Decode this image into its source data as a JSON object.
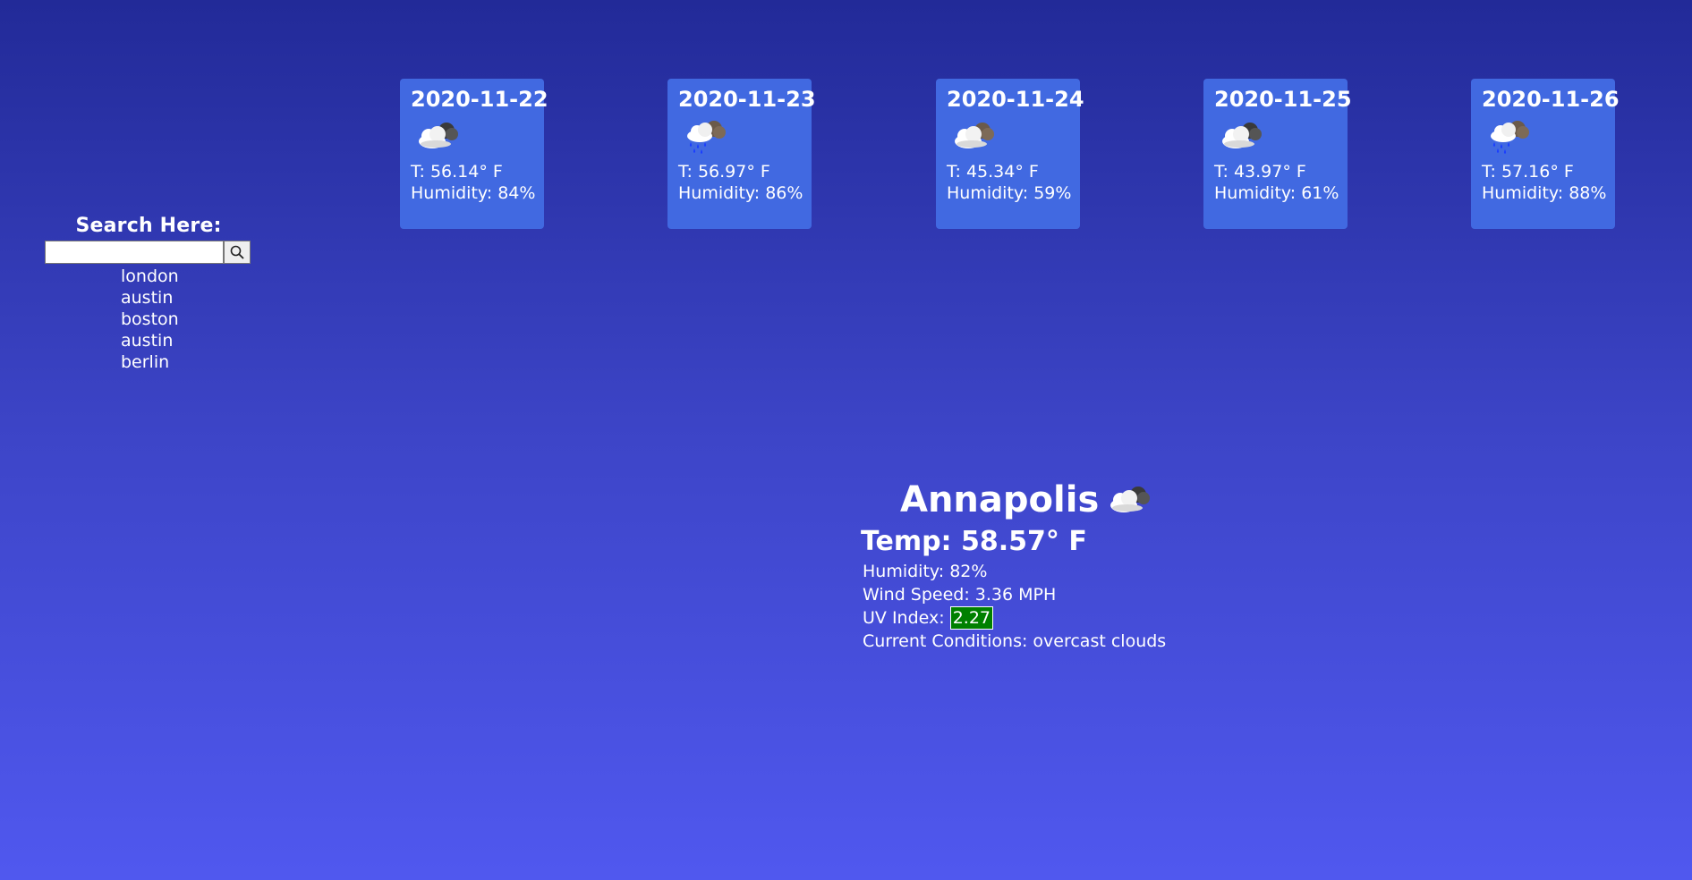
{
  "search": {
    "heading": "Search Here:",
    "input_value": "",
    "button_icon": "search-icon",
    "history": [
      "london",
      "austin",
      "boston",
      "austin",
      "berlin"
    ]
  },
  "forecast": [
    {
      "date": "2020-11-22",
      "icon": "cloud-icon",
      "temp": "T: 56.14° F",
      "humidity": "Humidity: 84%"
    },
    {
      "date": "2020-11-23",
      "icon": "rain-cloud-icon",
      "temp": "T: 56.97° F",
      "humidity": "Humidity: 86%"
    },
    {
      "date": "2020-11-24",
      "icon": "cloud-icon",
      "temp": "T: 45.34° F",
      "humidity": "Humidity: 59%"
    },
    {
      "date": "2020-11-25",
      "icon": "cloud-icon",
      "temp": "T: 43.97° F",
      "humidity": "Humidity: 61%"
    },
    {
      "date": "2020-11-26",
      "icon": "rain-cloud-icon",
      "temp": "T: 57.16° F",
      "humidity": "Humidity: 88%"
    }
  ],
  "current": {
    "city": "Annapolis",
    "icon": "cloud-icon",
    "temp": "Temp: 58.57° F",
    "humidity": "Humidity: 82%",
    "wind": "Wind Speed: 3.36 MPH",
    "uv_label": "UV Index: ",
    "uv_value": "2.27",
    "conditions": "Current Conditions: overcast clouds"
  },
  "colors": {
    "background_top": "#222a98",
    "background_bottom": "#5058ef",
    "card": "#4169e1",
    "uv_badge": "#008000"
  }
}
